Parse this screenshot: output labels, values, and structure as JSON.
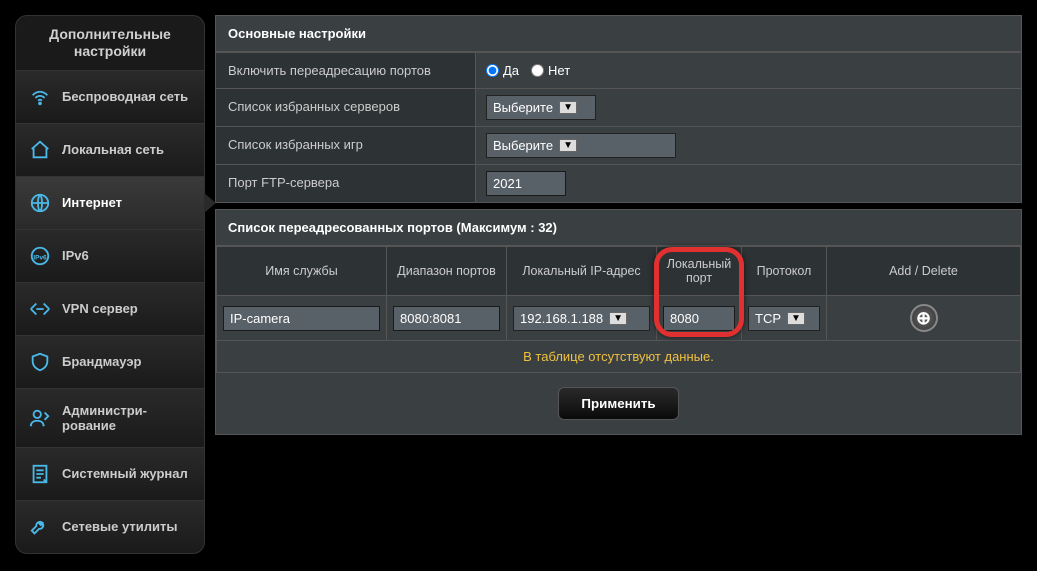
{
  "sidebar": {
    "title": "Дополнительные настройки",
    "items": [
      {
        "label": "Беспроводная сеть",
        "icon": "wifi"
      },
      {
        "label": "Локальная сеть",
        "icon": "home"
      },
      {
        "label": "Интернет",
        "icon": "globe"
      },
      {
        "label": "IPv6",
        "icon": "ipv6"
      },
      {
        "label": "VPN сервер",
        "icon": "vpn"
      },
      {
        "label": "Брандмауэр",
        "icon": "shield"
      },
      {
        "label": "Администри-\nрование",
        "icon": "admin"
      },
      {
        "label": "Системный журнал",
        "icon": "log"
      },
      {
        "label": "Сетевые утилиты",
        "icon": "tools"
      }
    ]
  },
  "basic": {
    "title": "Основные настройки",
    "rows": {
      "enable": {
        "label": "Включить переадресацию портов",
        "yes": "Да",
        "no": "Нет"
      },
      "servers": {
        "label": "Список избранных серверов",
        "value": "Выберите"
      },
      "games": {
        "label": "Список избранных игр",
        "value": "Выберите"
      },
      "ftp": {
        "label": "Порт FTP-сервера",
        "value": "2021"
      }
    }
  },
  "portlist": {
    "title": "Список переадресованных портов (Максимум : 32)",
    "headers": {
      "service": "Имя службы",
      "range": "Диапазон портов",
      "ip": "Локальный IP-адрес",
      "localport": "Локальный порт",
      "protocol": "Протокол",
      "action": "Add / Delete"
    },
    "row": {
      "service": "IP-camera",
      "range": "8080:8081",
      "ip": "192.168.1.188",
      "localport": "8080",
      "protocol": "TCP"
    },
    "empty": "В таблице отсутствуют данные.",
    "apply": "Применить"
  }
}
